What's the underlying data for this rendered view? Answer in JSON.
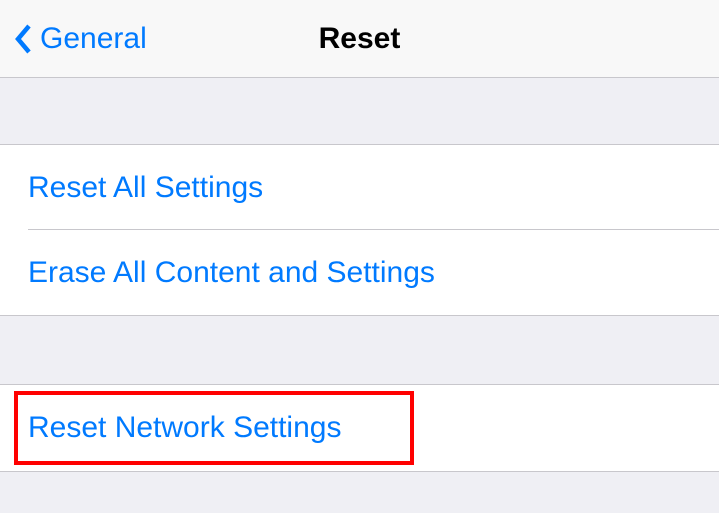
{
  "nav": {
    "back_label": "General",
    "title": "Reset"
  },
  "group1": {
    "items": [
      "Reset All Settings",
      "Erase All Content and Settings"
    ]
  },
  "group2": {
    "items": [
      "Reset Network Settings"
    ]
  }
}
